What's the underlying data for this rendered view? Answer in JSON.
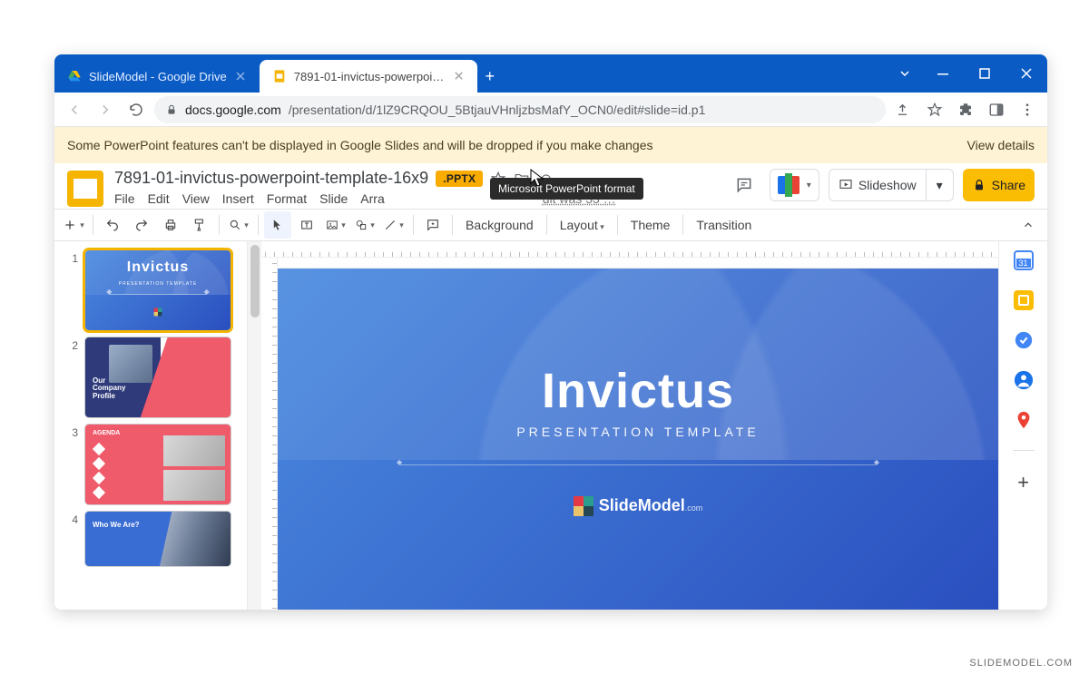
{
  "attribution": "SLIDEMODEL.COM",
  "browser": {
    "tabs": [
      {
        "label": "SlideModel - Google Drive",
        "active": false
      },
      {
        "label": "7891-01-invictus-powerpoint-te",
        "active": true
      }
    ],
    "url_host": "docs.google.com",
    "url_path": "/presentation/d/1lZ9CRQOU_5BtjauVHnljzbsMafY_OCN0/edit#slide=id.p1"
  },
  "banner": {
    "message": "Some PowerPoint features can't be displayed in Google Slides and will be dropped if you make changes",
    "action": "View details"
  },
  "doc": {
    "title": "7891-01-invictus-powerpoint-template-16x9",
    "badge": ".PPTX",
    "tooltip": "Microsoft PowerPoint format",
    "last_edit_partial": "dit was 53 …",
    "menus": [
      "File",
      "Edit",
      "View",
      "Insert",
      "Format",
      "Slide",
      "Arra"
    ]
  },
  "header_buttons": {
    "slideshow": "Slideshow",
    "share": "Share"
  },
  "toolbar": {
    "background": "Background",
    "layout": "Layout",
    "theme": "Theme",
    "transition": "Transition"
  },
  "slide_content": {
    "title": "Invictus",
    "subtitle": "PRESENTATION TEMPLATE",
    "brand": "SlideModel",
    "brand_suffix": ".com"
  },
  "thumbnails": [
    {
      "num": "1",
      "kind": "title",
      "label": "Invictus"
    },
    {
      "num": "2",
      "kind": "profile",
      "label": "Our Company Profile"
    },
    {
      "num": "3",
      "kind": "agenda",
      "label": "AGENDA"
    },
    {
      "num": "4",
      "kind": "who",
      "label": "Who We Are?"
    }
  ]
}
